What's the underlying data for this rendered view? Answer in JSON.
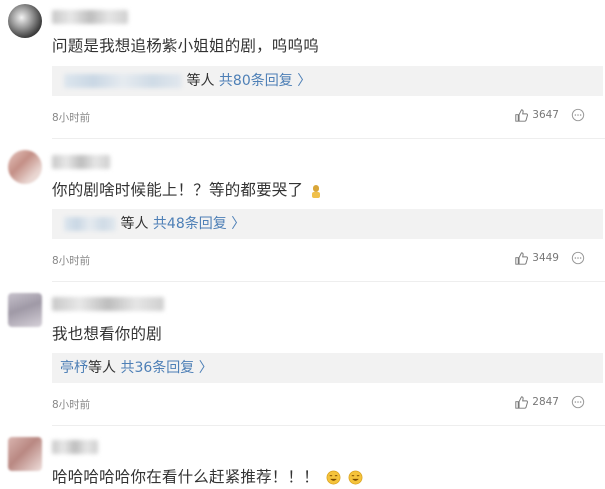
{
  "comments": [
    {
      "text": "问题是我想追杨紫小姐姐的剧，呜呜呜",
      "reply_suffix": "等人",
      "reply_count": "共80条回复",
      "time": "8小时前",
      "likes": "3647"
    },
    {
      "text": "你的剧啥时候能上！？等的都要哭了",
      "reply_suffix": "等人",
      "reply_count": "共48条回复",
      "time": "8小时前",
      "likes": "3449"
    },
    {
      "text": "我也想看你的剧",
      "reply_names": "亭杼",
      "reply_suffix": "等人",
      "reply_count": "共36条回复",
      "time": "8小时前",
      "likes": "2847"
    },
    {
      "text": "哈哈哈哈哈你在看什么赶紧推荐！！！"
    }
  ],
  "icons": {
    "like": "thumbs-up-icon",
    "more": "more-icon",
    "chevron": "chevron-right-icon"
  },
  "colors": {
    "link": "#4d7fb6",
    "reply_bg": "#f2f2f2",
    "text": "#333333",
    "meta": "#888888"
  }
}
